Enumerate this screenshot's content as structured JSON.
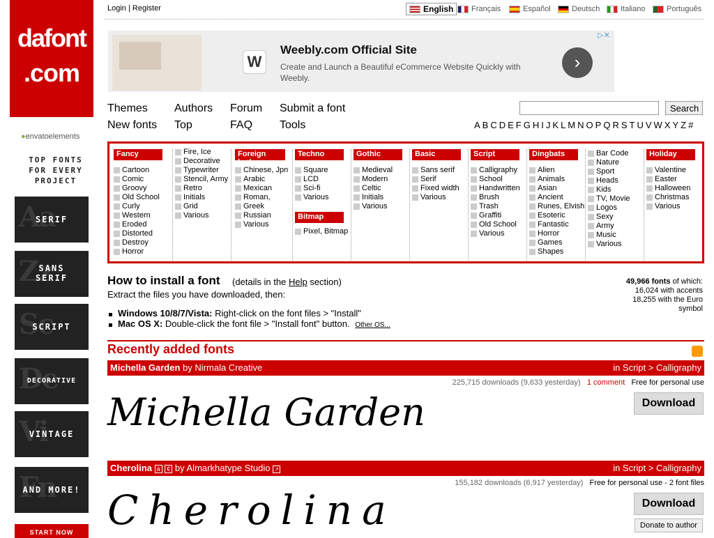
{
  "account": {
    "login": "Login",
    "separator": "|",
    "register": "Register"
  },
  "languages": [
    {
      "label": "English",
      "active": true
    },
    {
      "label": "Français",
      "active": false
    },
    {
      "label": "Español",
      "active": false
    },
    {
      "label": "Deutsch",
      "active": false
    },
    {
      "label": "Italiano",
      "active": false
    },
    {
      "label": "Português",
      "active": false
    }
  ],
  "logo": {
    "line1": "dafont",
    "line2": ".com"
  },
  "sidebar": {
    "envato": "envatoelements",
    "top_fonts": [
      "TOP FONTS",
      "FOR EVERY",
      "PROJECT"
    ],
    "promos": [
      "SERIF",
      "SANS SERIF",
      "SCRIPT",
      "DECORATIVE",
      "VINTAGE",
      "AND MORE!"
    ],
    "start_now": "START NOW"
  },
  "ad": {
    "title": "Weebly.com Official Site",
    "description": "Create and Launch a Beautiful eCommerce Website Quickly with Weebly.",
    "logo_letter": "W",
    "arrow": "›",
    "adchoices": "▷✕"
  },
  "nav": {
    "themes": "Themes",
    "authors": "Authors",
    "forum": "Forum",
    "submit": "Submit a font",
    "new_fonts": "New fonts",
    "top": "Top",
    "faq": "FAQ",
    "tools": "Tools",
    "search_button": "Search",
    "alphabet": [
      "A",
      "B",
      "C",
      "D",
      "E",
      "F",
      "G",
      "H",
      "I",
      "J",
      "K",
      "L",
      "M",
      "N",
      "O",
      "P",
      "Q",
      "R",
      "S",
      "T",
      "U",
      "V",
      "W",
      "X",
      "Y",
      "Z",
      "#"
    ]
  },
  "categories": {
    "fancy": {
      "title": "Fancy",
      "items": [
        "Cartoon",
        "Comic",
        "Groovy",
        "Old School",
        "Curly",
        "Western",
        "Eroded",
        "Distorted",
        "Destroy",
        "Horror"
      ]
    },
    "fancy2": {
      "items": [
        "Fire, Ice",
        "Decorative",
        "Typewriter",
        "Stencil, Army",
        "Retro",
        "Initials",
        "Grid",
        "Various"
      ]
    },
    "foreign": {
      "title": "Foreign look",
      "items": [
        "Chinese, Jpn",
        "Arabic",
        "Mexican",
        "Roman,",
        "Greek",
        "Russian",
        "Various"
      ]
    },
    "techno": {
      "title": "Techno",
      "items": [
        "Square",
        "LCD",
        "Sci-fi",
        "Various"
      ]
    },
    "bitmap": {
      "title": "Bitmap",
      "items": [
        "Pixel, Bitmap"
      ]
    },
    "gothic": {
      "title": "Gothic",
      "items": [
        "Medieval",
        "Modern",
        "Celtic",
        "Initials",
        "Various"
      ]
    },
    "basic": {
      "title": "Basic",
      "items": [
        "Sans serif",
        "Serif",
        "Fixed width",
        "Various"
      ]
    },
    "script": {
      "title": "Script",
      "items": [
        "Calligraphy",
        "School",
        "Handwritten",
        "Brush",
        "Trash",
        "Graffiti",
        "Old School",
        "Various"
      ]
    },
    "dingbats": {
      "title": "Dingbats",
      "items": [
        "Alien",
        "Animals",
        "Asian",
        "Ancient",
        "Runes, Elvish",
        "Esoteric",
        "Fantastic",
        "Horror",
        "Games",
        "Shapes"
      ]
    },
    "dingbats2": {
      "items": [
        "Bar Code",
        "Nature",
        "Sport",
        "Heads",
        "Kids",
        "TV, Movie",
        "Logos",
        "Sexy",
        "Army",
        "Music",
        "Various"
      ]
    },
    "holiday": {
      "title": "Holiday",
      "items": [
        "Valentine",
        "Easter",
        "Halloween",
        "Christmas",
        "Various"
      ]
    }
  },
  "install": {
    "title": "How to install a font",
    "details_prefix": "(details in the",
    "details_link": "Help",
    "details_suffix": "section)",
    "extract": "Extract the files you have downloaded, then:",
    "win_label": "Windows 10/8/7/Vista:",
    "win_text": "Right-click on the font files > \"Install\"",
    "mac_label": "Mac OS X:",
    "mac_text": "Double-click the font file > \"Install font\" button.",
    "other_os": "Other OS..."
  },
  "stats": {
    "total": "49,966 fonts",
    "total_suffix": "of which:",
    "accents": "16,024 with accents",
    "euro": "18,255 with the Euro symbol"
  },
  "recent": {
    "title": "Recently added fonts",
    "fonts": [
      {
        "name": "Michella Garden",
        "by": "by",
        "author": "Nirmala Creative",
        "category": "in Script > Calligraphy",
        "downloads": "225,715 downloads (9,633 yesterday)",
        "comments": "1 comment",
        "license": "Free for personal use",
        "preview": "Michella Garden",
        "download": "Download"
      },
      {
        "name": "Cherolina",
        "by": "by",
        "author": "Almarkhatype Studio",
        "category": "in Script > Calligraphy",
        "downloads": "155,182 downloads (6,917 yesterday)",
        "license": "Free for personal use - 2 font files",
        "preview": "Cherolina",
        "download": "Download",
        "donate": "Donate to author"
      }
    ]
  },
  "colors": {
    "brand_red": "#cc0000",
    "rss_orange": "#ff9900"
  }
}
